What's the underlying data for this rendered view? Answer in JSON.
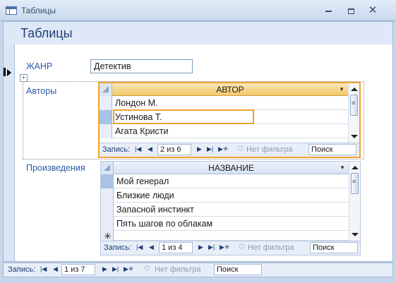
{
  "window": {
    "title": "Таблицы",
    "min_glyph": "",
    "close_glyph": "✕"
  },
  "form": {
    "title": "Таблицы",
    "genre_label": "ЖАНР",
    "genre_value": "Детектив",
    "authors_label": "Авторы",
    "works_label": "Произведения"
  },
  "authors_grid": {
    "column": "АВТОР",
    "rows": [
      "Лондон М.",
      "Устинова Т.",
      "Агата Кристи"
    ],
    "nav": {
      "record_label": "Запись:",
      "position": "2 из 6",
      "filter": "Нет фильтра",
      "search": "Поиск"
    }
  },
  "works_grid": {
    "column": "НАЗВАНИЕ",
    "rows": [
      "Мой генерал",
      "Близкие люди",
      "Запасной инстинкт",
      "Пять шагов по облакам"
    ],
    "new_row_marker": "✳",
    "nav": {
      "record_label": "Запись:",
      "position": "1 из 4",
      "filter": "Нет фильтра",
      "search": "Поиск"
    }
  },
  "main_nav": {
    "record_label": "Запись:",
    "position": "1 из 7",
    "filter": "Нет фильтра",
    "search": "Поиск"
  },
  "nav_glyphs": {
    "first": "|◀",
    "prev": "◀",
    "next": "▶",
    "last": "▶|",
    "new": "▶✳",
    "filter_icon": "⛉"
  },
  "colors": {
    "accent": "#f0a230",
    "label": "#2a5aa8",
    "title": "#1f3f74"
  }
}
